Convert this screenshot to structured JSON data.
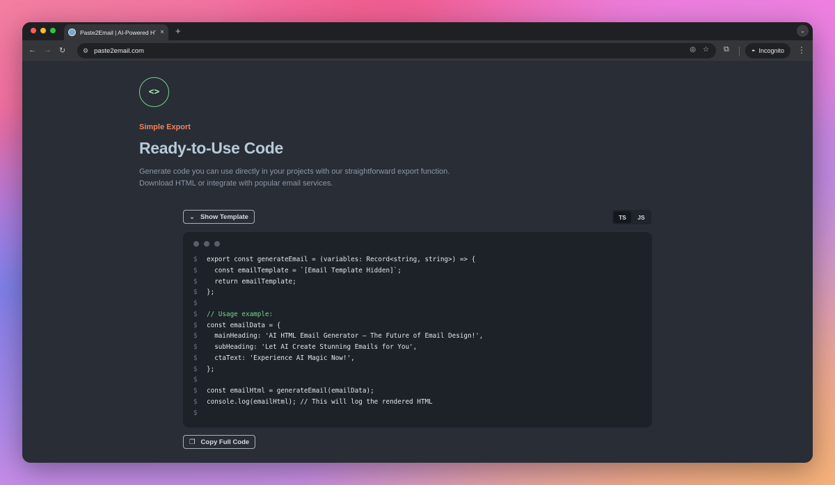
{
  "browser": {
    "tab_title": "Paste2Email | AI-Powered HT",
    "tab_close": "×",
    "new_tab": "+",
    "url": "paste2email.com",
    "incognito_label": "Incognito"
  },
  "hero": {
    "icon": "<>",
    "eyebrow": "Simple Export",
    "title": "Ready-to-Use Code",
    "description_line1": "Generate code you can use directly in your projects with our straightforward export function.",
    "description_line2": "Download HTML or integrate with popular email services."
  },
  "controls": {
    "show_template_label": "Show Template",
    "lang_options": [
      "TS",
      "JS"
    ],
    "lang_selected": "TS",
    "copy_label": "Copy Full Code"
  },
  "code": {
    "prompt": "$",
    "lines": [
      {
        "text": "export const generateEmail = (variables: Record<string, string>) => {",
        "type": "code"
      },
      {
        "text": "  const emailTemplate = `[Email Template Hidden]`;",
        "type": "code"
      },
      {
        "text": "  return emailTemplate;",
        "type": "code"
      },
      {
        "text": "};",
        "type": "code"
      },
      {
        "text": "",
        "type": "code"
      },
      {
        "text": "// Usage example:",
        "type": "comment"
      },
      {
        "text": "const emailData = {",
        "type": "code"
      },
      {
        "text": "  mainHeading: 'AI HTML Email Generator – The Future of Email Design!',",
        "type": "code"
      },
      {
        "text": "  subHeading: 'Let AI Create Stunning Emails for You',",
        "type": "code"
      },
      {
        "text": "  ctaText: 'Experience AI Magic Now!',",
        "type": "code"
      },
      {
        "text": "};",
        "type": "code"
      },
      {
        "text": "",
        "type": "code"
      },
      {
        "text": "const emailHtml = generateEmail(emailData);",
        "type": "code"
      },
      {
        "text": "console.log(emailHtml); // This will log the rendered HTML",
        "type": "code"
      },
      {
        "text": "",
        "type": "code"
      }
    ]
  },
  "colors": {
    "accent_orange": "#f0855c",
    "accent_green": "#7bd38b",
    "page_bg": "#282d36",
    "code_bg": "#1d2128"
  }
}
